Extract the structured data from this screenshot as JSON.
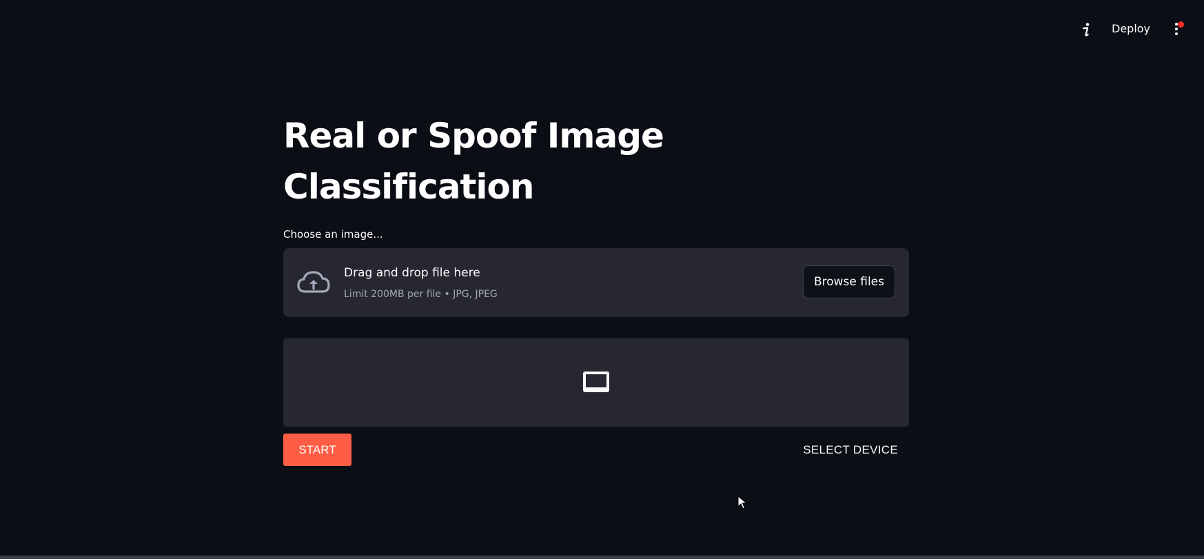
{
  "header": {
    "info_icon": "info-icon",
    "deploy_label": "Deploy",
    "menu_icon": "kebab-menu-icon",
    "notification_color": "#ff2b2b"
  },
  "main": {
    "title": "Real or Spoof Image Classification",
    "uploader": {
      "label": "Choose an image...",
      "icon": "cloud-upload-icon",
      "drop_text": "Drag and drop file here",
      "limit_text": "Limit 200MB per file • JPG, JPEG",
      "browse_label": "Browse files"
    },
    "webcam": {
      "icon": "monitor-icon"
    },
    "controls": {
      "start_label": "START",
      "select_device_label": "SELECT DEVICE",
      "start_color": "#ff5c45"
    }
  },
  "theme": {
    "background": "#0b0e14",
    "panel": "#262730",
    "text": "#fafafa"
  }
}
